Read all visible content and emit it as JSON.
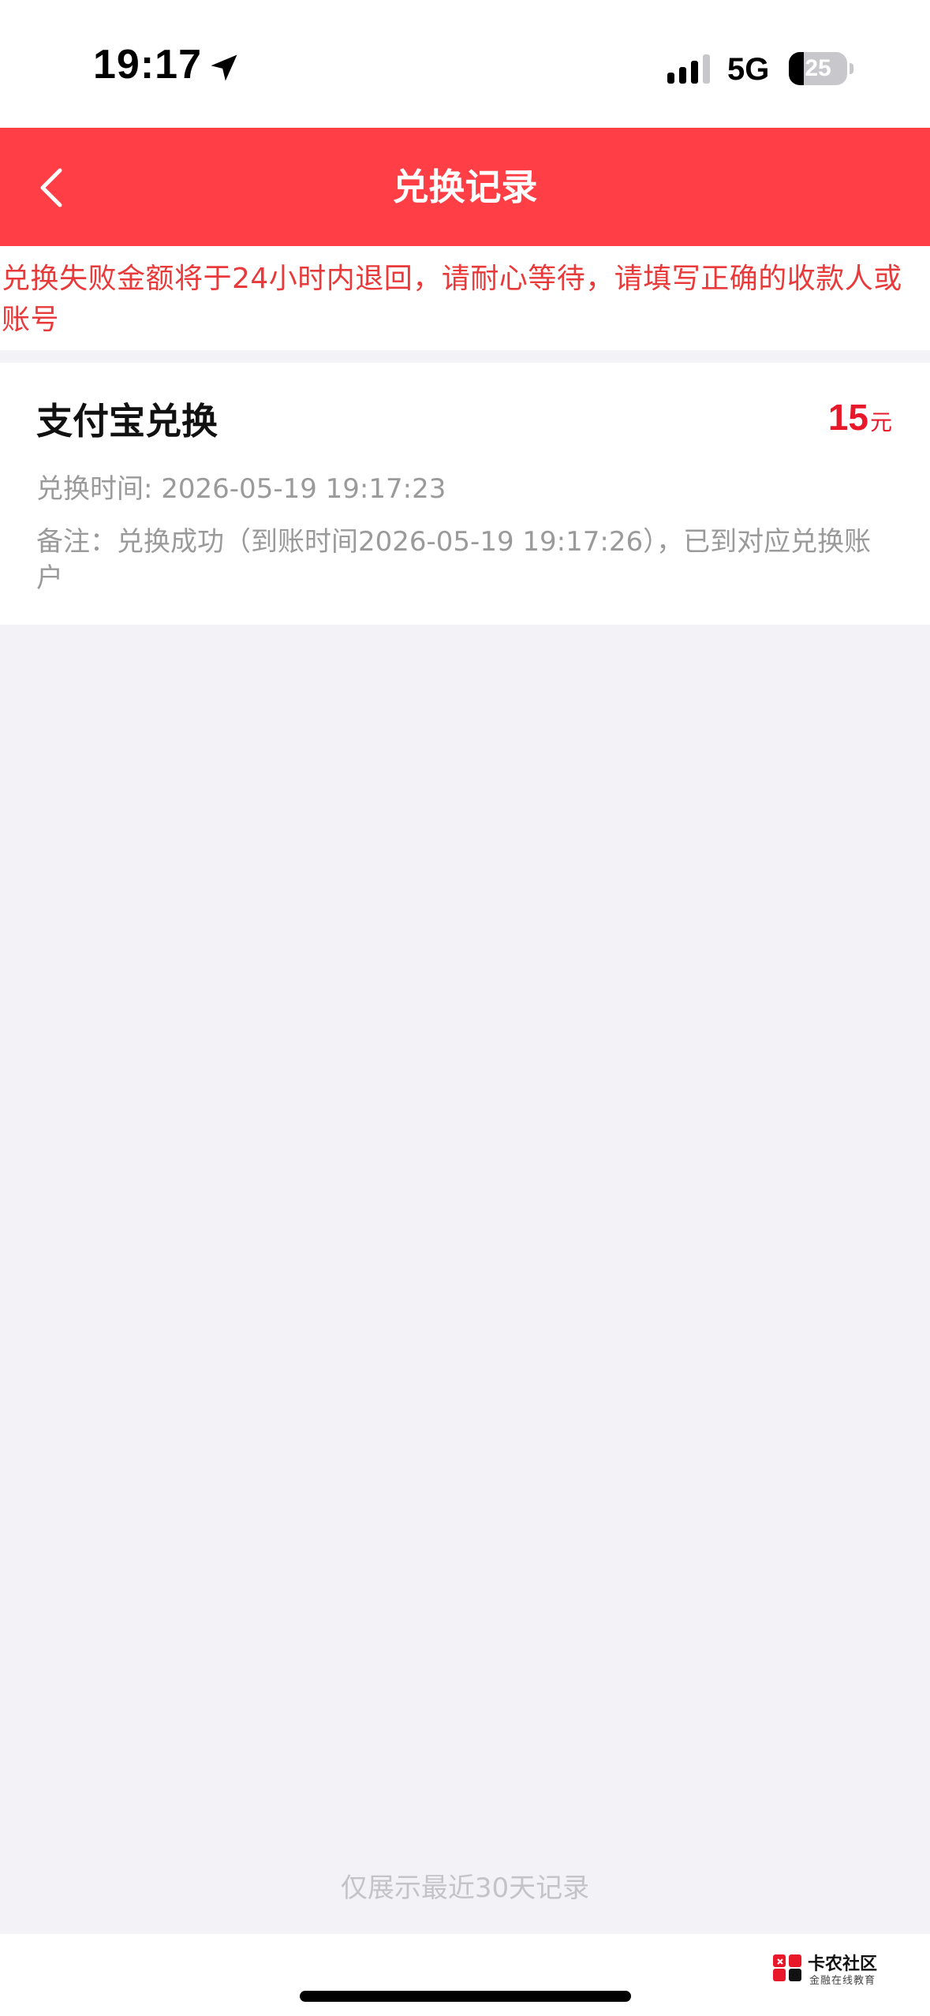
{
  "status_bar": {
    "time": "19:17",
    "network": "5G",
    "battery": "25",
    "battery_fraction": 0.25
  },
  "nav": {
    "title": "兑换记录",
    "back_icon": "chevron-left-icon"
  },
  "notice": {
    "text": "兑换失败金额将于24小时内退回，请耐心等待，请填写正确的收款人或账号"
  },
  "record": {
    "title": "支付宝兑换",
    "amount": "15",
    "unit": "元",
    "time": "兑换时间: 2026-05-19 19:17:23",
    "note": "备注：兑换成功（到账时间2026-05-19 19:17:26），已到对应兑换账户"
  },
  "footer": {
    "hint": "仅展示最近30天记录"
  },
  "watermark": {
    "title": "卡农社区",
    "subtitle": "金融在线教育"
  },
  "colors": {
    "nav_background": "#ff3e45",
    "notice_text": "#e83a3a",
    "amount": "#e8182a",
    "page_background": "#f2f2f7"
  }
}
